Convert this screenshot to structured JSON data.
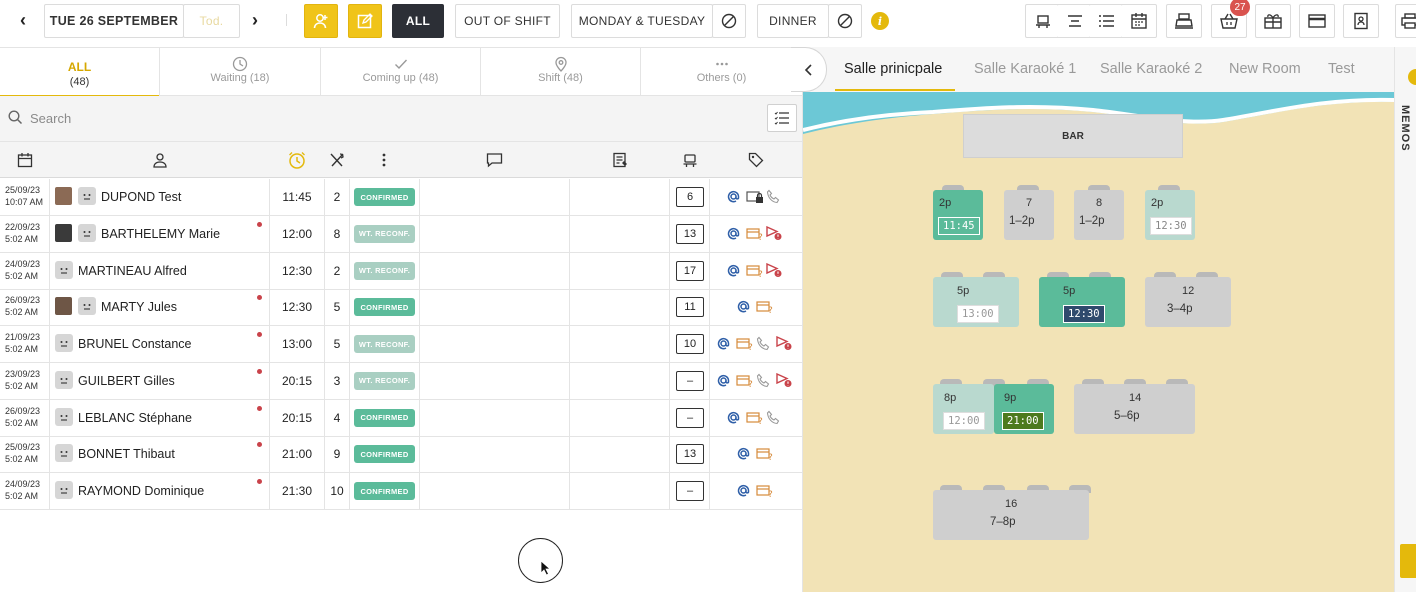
{
  "toolbar": {
    "date": "TUE 26 SEPTEMBER",
    "today": "Tod.",
    "filter_all": "ALL",
    "out_of_shift": "OUT OF SHIFT",
    "days": "MONDAY & TUESDAY",
    "service": "DINNER",
    "cart_badge": "27",
    "info_icon": "i"
  },
  "tabs": [
    {
      "label": "ALL",
      "count": "(48)"
    },
    {
      "label": "Waiting (18)"
    },
    {
      "label": "Coming up (48)"
    },
    {
      "label": "Shift (48)"
    },
    {
      "label": "Others (0)"
    }
  ],
  "search": {
    "placeholder": "Search"
  },
  "status_labels": {
    "confirmed": "CONFIRMED",
    "waiting": "WT. RECONF."
  },
  "reservations": [
    {
      "d1": "25/09/23",
      "d2": "10:07 AM",
      "name": "DUPOND Test",
      "time": "11:45",
      "covers": "2",
      "status": "CONFIRMED",
      "table": "6"
    },
    {
      "d1": "22/09/23",
      "d2": "5:02 AM",
      "name": "BARTHELEMY Marie",
      "time": "12:00",
      "covers": "8",
      "status": "WT. RECONF.",
      "table": "13"
    },
    {
      "d1": "24/09/23",
      "d2": "5:02 AM",
      "name": "MARTINEAU Alfred",
      "time": "12:30",
      "covers": "2",
      "status": "WT. RECONF.",
      "table": "17"
    },
    {
      "d1": "26/09/23",
      "d2": "5:02 AM",
      "name": "MARTY Jules",
      "time": "12:30",
      "covers": "5",
      "status": "CONFIRMED",
      "table": "11"
    },
    {
      "d1": "21/09/23",
      "d2": "5:02 AM",
      "name": "BRUNEL Constance",
      "time": "13:00",
      "covers": "5",
      "status": "WT. RECONF.",
      "table": "10"
    },
    {
      "d1": "23/09/23",
      "d2": "5:02 AM",
      "name": "GUILBERT Gilles",
      "time": "20:15",
      "covers": "3",
      "status": "WT. RECONF.",
      "table": "–"
    },
    {
      "d1": "26/09/23",
      "d2": "5:02 AM",
      "name": "LEBLANC Stéphane",
      "time": "20:15",
      "covers": "4",
      "status": "CONFIRMED",
      "table": "–"
    },
    {
      "d1": "25/09/23",
      "d2": "5:02 AM",
      "name": "BONNET Thibaut",
      "time": "21:00",
      "covers": "9",
      "status": "CONFIRMED",
      "table": "13"
    },
    {
      "d1": "24/09/23",
      "d2": "5:02 AM",
      "name": "RAYMOND Dominique",
      "time": "21:30",
      "covers": "10",
      "status": "CONFIRMED",
      "table": "–"
    }
  ],
  "rooms": [
    "Salle prinicpale",
    "Salle Karaoké 1",
    "Salle Karaoké 2",
    "New Room",
    "Test"
  ],
  "floor": {
    "bar": "BAR",
    "tables": [
      {
        "id": "t2p",
        "label": "2p",
        "time": "11:45"
      },
      {
        "id": "t7",
        "label": "7",
        "sub": "1–2p"
      },
      {
        "id": "t8",
        "label": "8",
        "sub": "1–2p"
      },
      {
        "id": "t2pb",
        "label": "2p",
        "time": "12:30"
      },
      {
        "id": "t5p",
        "label": "5p",
        "time": "13:00"
      },
      {
        "id": "t5pb",
        "label": "5p",
        "time": "12:30"
      },
      {
        "id": "t12",
        "label": "12",
        "sub": "3–4p"
      },
      {
        "id": "t8p",
        "label": "8p",
        "time": "12:00"
      },
      {
        "id": "t9p",
        "label": "9p",
        "time": "21:00"
      },
      {
        "id": "t14",
        "label": "14",
        "sub": "5–6p"
      },
      {
        "id": "t16",
        "label": "16",
        "sub": "7–8p"
      }
    ]
  },
  "memos": "MEMOS",
  "colors": {
    "accent": "#e4b90c",
    "confirmed": "#5bbb9a",
    "waiting": "#a9cfc2",
    "dark": "#2c2f36",
    "floor": "#f2e3b6",
    "sea": "#6cc8d6",
    "alert": "#c9434a"
  }
}
